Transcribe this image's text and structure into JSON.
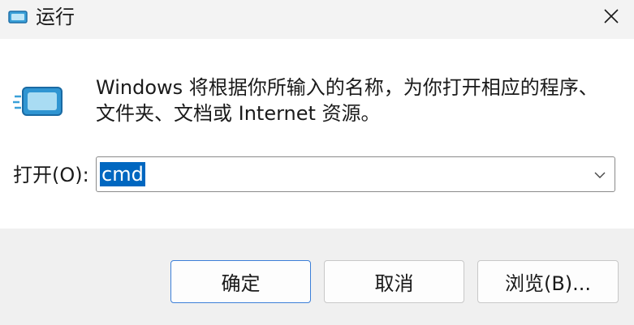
{
  "window": {
    "title": "运行",
    "icon": "run-icon",
    "close_icon": "close-icon"
  },
  "body": {
    "message_line1": "Windows 将根据你所输入的名称，为你打开相应的程序、",
    "message_line2": "文件夹、文档或 Internet 资源。",
    "open_label": "打开(O):",
    "open_value": "cmd",
    "dropdown_icon": "chevron-down-icon"
  },
  "buttons": {
    "ok": "确定",
    "cancel": "取消",
    "browse": "浏览(B)..."
  },
  "colors": {
    "accent": "#0067c0",
    "primary_border": "#3c7fd8",
    "footer_bg": "#f0f0f0",
    "titlebar_bg": "#f3f3f3"
  }
}
